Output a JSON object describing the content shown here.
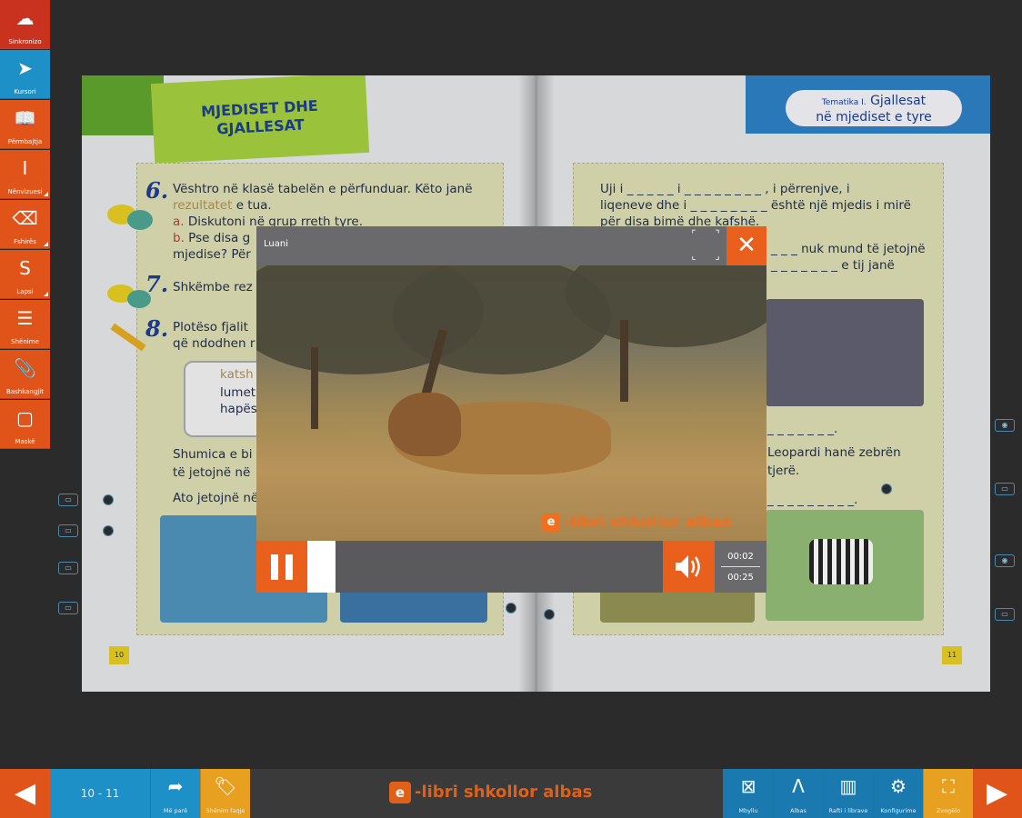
{
  "left_toolbar": [
    {
      "icon": "cloud-icon",
      "glyph": "☁",
      "label": "Sinkronizo",
      "style": "cloud"
    },
    {
      "icon": "cursor-icon",
      "glyph": "➤",
      "label": "Kursori",
      "style": "active"
    },
    {
      "icon": "book-icon",
      "glyph": "📖",
      "label": "Përmbajtja",
      "style": ""
    },
    {
      "icon": "text-cursor-icon",
      "glyph": "I",
      "label": "Nënvizuesi",
      "style": ""
    },
    {
      "icon": "eraser-icon",
      "glyph": "⌫",
      "label": "Fshirës",
      "style": ""
    },
    {
      "icon": "pen-icon",
      "glyph": "S",
      "label": "Lapsi",
      "style": ""
    },
    {
      "icon": "note-icon",
      "glyph": "☰",
      "label": "Shënime",
      "style": ""
    },
    {
      "icon": "paperclip-icon",
      "glyph": "📎",
      "label": "Bashkangjit",
      "style": ""
    },
    {
      "icon": "mask-icon",
      "glyph": "▢",
      "label": "Maskë",
      "style": ""
    }
  ],
  "book": {
    "title_badge": "MJEDISET DHE\nGJALLESAT",
    "theme_small": "Tematika I.",
    "theme_big": "Gjallesat\nnë mjediset e tyre",
    "left_page_number": "10",
    "right_page_number": "11",
    "left_lines": [
      {
        "num": "6.",
        "text": "Vështro në klasë tabelën e përfunduar. Këto janë"
      },
      {
        "text_hl": "rezultatet",
        "text": " e tua."
      },
      {
        "text_red": "a.",
        "text": " Diskutoni në grup rreth tyre."
      },
      {
        "text_red": "b.",
        "text": " Pse disa g"
      },
      {
        "text": "mjedise? Për"
      }
    ],
    "line7": "Shkëmbe rez",
    "line8a": "Plotëso fjalit",
    "line8b": "që ndodhen r",
    "box_words": [
      "katsh",
      "lumet",
      "hapës"
    ],
    "left_bottom_1": "Shumica e bi",
    "left_bottom_2": "të jetojnë në",
    "left_bottom_3": "Ato jetojnë në",
    "right_lines": [
      "Uji i _ _ _ _ _  i  _ _ _ _ _ _ _ _ , i përrenjve, i",
      "liqeneve dhe i _ _ _ _ _ _ _ _ është një mjedis i mirë",
      "për disa bimë dhe kafshë."
    ],
    "right_mid_1": "_ _ _ nuk mund të jetojnë",
    "right_mid_2": "_ _ _ _ _ _ _ e tij janë",
    "right_low_1": "_ _ _ _ _ _ _.",
    "right_low_2": "Leopardi hanë zebrën",
    "right_low_3": "tjerë.",
    "right_low_4": "_ _ _ _ _ _ _ _ _."
  },
  "video_modal": {
    "title": "Luani",
    "close_glyph": "✕",
    "progress": 0.08,
    "current_time": "00:02",
    "total_time": "00:25",
    "watermark": "-libri shkollor albas",
    "watermark_logo": "e"
  },
  "bottom_bar": {
    "prev_glyph": "◀",
    "next_glyph": "▶",
    "page_indicator": "10 - 11",
    "brand_logo": "e",
    "brand_text": "-libri shkollor albas",
    "left_buttons": [
      {
        "icon": "share-arrow-icon",
        "glyph": "➦",
        "label": "Më parë"
      },
      {
        "icon": "tag-icon",
        "glyph": "🏷",
        "label": "Shënim faqje",
        "style": "orange"
      }
    ],
    "right_buttons": [
      {
        "icon": "close-box-icon",
        "glyph": "⊠",
        "label": "Mbyllu",
        "style": "dark"
      },
      {
        "icon": "albas-logo-icon",
        "glyph": "Λ",
        "label": "Albas",
        "style": "dark"
      },
      {
        "icon": "bookshelf-icon",
        "glyph": "▥",
        "label": "Rafti i librave",
        "style": "dark"
      },
      {
        "icon": "settings-icon",
        "glyph": "⚙",
        "label": "Konfigurime",
        "style": "dark"
      },
      {
        "icon": "zoom-fullscreen-icon",
        "glyph": "⛶",
        "label": "Zvogëlo",
        "style": "orange"
      }
    ]
  }
}
